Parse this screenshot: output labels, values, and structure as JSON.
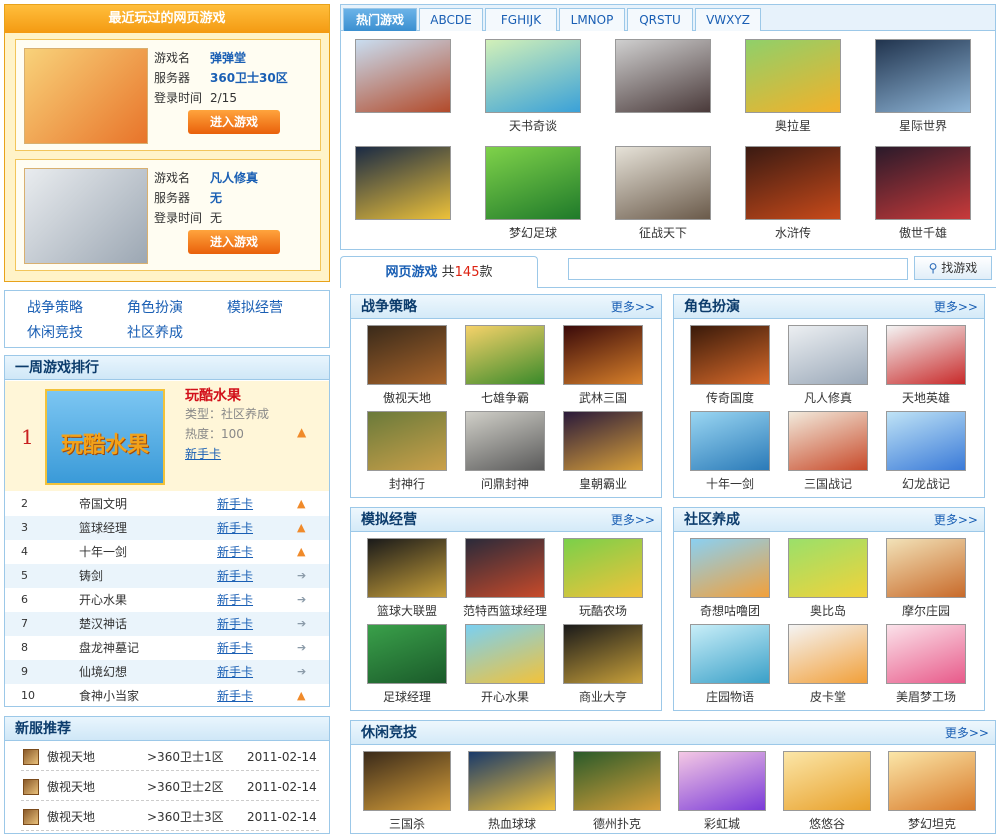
{
  "recent": {
    "title": "最近玩过的网页游戏",
    "labels": {
      "game": "游戏名",
      "server": "服务器",
      "time": "登录时间"
    },
    "cards": [
      {
        "game": "弹弹堂",
        "server": "360卫士30区",
        "time": "2/15",
        "button": "进入游戏",
        "thumb_colors": [
          "#f8d27a",
          "#e8742a"
        ]
      },
      {
        "game": "凡人修真",
        "server": "无",
        "time": "无",
        "button": "进入游戏",
        "thumb_colors": [
          "#e9ecef",
          "#9ca7b3"
        ]
      }
    ]
  },
  "categories": [
    "战争策略",
    "角色扮演",
    "模拟经营",
    "休闲竞技",
    "社区养成"
  ],
  "weekly": {
    "title": "一周游戏排行",
    "top": {
      "rank": "1",
      "name": "玩酷水果",
      "type": "类型：社区养成",
      "heat": "热度：100",
      "link": "新手卡"
    },
    "rows": [
      {
        "rank": "2",
        "name": "帝国文明",
        "link": "新手卡",
        "trend": "up"
      },
      {
        "rank": "3",
        "name": "篮球经理",
        "link": "新手卡",
        "trend": "up"
      },
      {
        "rank": "4",
        "name": "十年一剑",
        "link": "新手卡",
        "trend": "up"
      },
      {
        "rank": "5",
        "name": "铸剑",
        "link": "新手卡",
        "trend": "flat"
      },
      {
        "rank": "6",
        "name": "开心水果",
        "link": "新手卡",
        "trend": "flat"
      },
      {
        "rank": "7",
        "name": "楚汉神话",
        "link": "新手卡",
        "trend": "flat"
      },
      {
        "rank": "8",
        "name": "盘龙神墓记",
        "link": "新手卡",
        "trend": "flat"
      },
      {
        "rank": "9",
        "name": "仙境幻想",
        "link": "新手卡",
        "trend": "flat"
      },
      {
        "rank": "10",
        "name": "食神小当家",
        "link": "新手卡",
        "trend": "up"
      }
    ]
  },
  "newserver": {
    "title": "新服推荐",
    "rows": [
      {
        "game": "傲视天地",
        "server": ">360卫士1区",
        "date": "2011-02-14"
      },
      {
        "game": "傲视天地",
        "server": ">360卫士2区",
        "date": "2011-02-14"
      },
      {
        "game": "傲视天地",
        "server": ">360卫士3区",
        "date": "2011-02-14"
      }
    ]
  },
  "hot": {
    "tabs": [
      "热门游戏",
      "ABCDE",
      "FGHIJK",
      "LMNOP",
      "QRSTU",
      "VWXYZ"
    ],
    "games": [
      {
        "name": "",
        "c": [
          "#c9ddf0",
          "#b24a2a"
        ]
      },
      {
        "name": "天书奇谈",
        "c": [
          "#d2f0b8",
          "#3aa1d8"
        ]
      },
      {
        "name": "",
        "c": [
          "#cfcfcf",
          "#4a3a3a"
        ]
      },
      {
        "name": "奥拉星",
        "c": [
          "#8fd06a",
          "#f3b12a"
        ]
      },
      {
        "name": "星际世界",
        "c": [
          "#21344e",
          "#8fb6d8"
        ]
      },
      {
        "name": "",
        "c": [
          "#1a2a44",
          "#ecc13a"
        ]
      },
      {
        "name": "梦幻足球",
        "c": [
          "#7fd24a",
          "#1f7a2a"
        ]
      },
      {
        "name": "征战天下",
        "c": [
          "#e6e2d8",
          "#6a5a4a"
        ]
      },
      {
        "name": "水浒传",
        "c": [
          "#3a1a12",
          "#c84a1a"
        ]
      },
      {
        "name": "傲世千雄",
        "c": [
          "#2a1a2a",
          "#c83a3a"
        ]
      }
    ]
  },
  "webgames": {
    "label": "网页游戏",
    "count_prefix": "共",
    "count": "145",
    "count_suffix": "款",
    "search_button": "找游戏",
    "search_value": ""
  },
  "sections": [
    {
      "title": "战争策略",
      "more": "更多>>",
      "games": [
        "傲视天地",
        "七雄争霸",
        "武林三国",
        "封神行",
        "问鼎封神",
        "皇朝霸业"
      ],
      "colors": [
        [
          "#3a2a1a",
          "#a8642a"
        ],
        [
          "#f6d26a",
          "#3a8a2a"
        ],
        [
          "#3a0a0a",
          "#d8802a"
        ],
        [
          "#6a7a3a",
          "#caa04a"
        ],
        [
          "#d0cfc8",
          "#5a5a5a"
        ],
        [
          "#2a1a3a",
          "#d8a03a"
        ]
      ]
    },
    {
      "title": "角色扮演",
      "more": "更多>>",
      "games": [
        "传奇国度",
        "凡人修真",
        "天地英雄",
        "十年一剑",
        "三国战记",
        "幻龙战记"
      ],
      "colors": [
        [
          "#3a1a0a",
          "#d86a2a"
        ],
        [
          "#eceff2",
          "#9aa8b8"
        ],
        [
          "#f4f4f4",
          "#c82a2a"
        ],
        [
          "#9ad6f2",
          "#2a7ab8"
        ],
        [
          "#f2eadc",
          "#c84a2a"
        ],
        [
          "#bfe3f6",
          "#3a7ad8"
        ]
      ]
    },
    {
      "title": "模拟经营",
      "more": "更多>>",
      "games": [
        "篮球大联盟",
        "范特西篮球经理",
        "玩酷农场",
        "足球经理",
        "开心水果",
        "商业大亨"
      ],
      "colors": [
        [
          "#1a1a1a",
          "#c8a03a"
        ],
        [
          "#2a2a3a",
          "#c84a2a"
        ],
        [
          "#7ad04a",
          "#f2c23a"
        ],
        [
          "#3aa04a",
          "#1a5a2a"
        ],
        [
          "#7ad0f2",
          "#f2c23a"
        ],
        [
          "#1a1a1a",
          "#c8a03a"
        ]
      ]
    },
    {
      "title": "社区养成",
      "more": "更多>>",
      "games": [
        "奇想咕噜团",
        "奥比岛",
        "摩尔庄园",
        "庄园物语",
        "皮卡堂",
        "美眉梦工场"
      ],
      "colors": [
        [
          "#8ad0f2",
          "#f2a03a"
        ],
        [
          "#9ae06a",
          "#f2d23a"
        ],
        [
          "#f2e2b8",
          "#c86a2a"
        ],
        [
          "#c8eef8",
          "#3aa0c8"
        ],
        [
          "#f4f4f4",
          "#f2a03a"
        ],
        [
          "#fbe2ea",
          "#e85a8a"
        ]
      ]
    },
    {
      "title": "休闲竞技",
      "more": "更多>>",
      "games": [
        "三国杀",
        "热血球球",
        "德州扑克",
        "彩虹城",
        "悠悠谷",
        "梦幻坦克"
      ],
      "colors": [
        [
          "#3a2a1a",
          "#d8a03a"
        ],
        [
          "#1a3a6a",
          "#f2c23a"
        ],
        [
          "#2a5a2a",
          "#d8a03a"
        ],
        [
          "#f4c8e4",
          "#7a3ad8"
        ],
        [
          "#fbe6a8",
          "#e8a02a"
        ],
        [
          "#fbe6a8",
          "#d87a2a"
        ]
      ]
    }
  ]
}
